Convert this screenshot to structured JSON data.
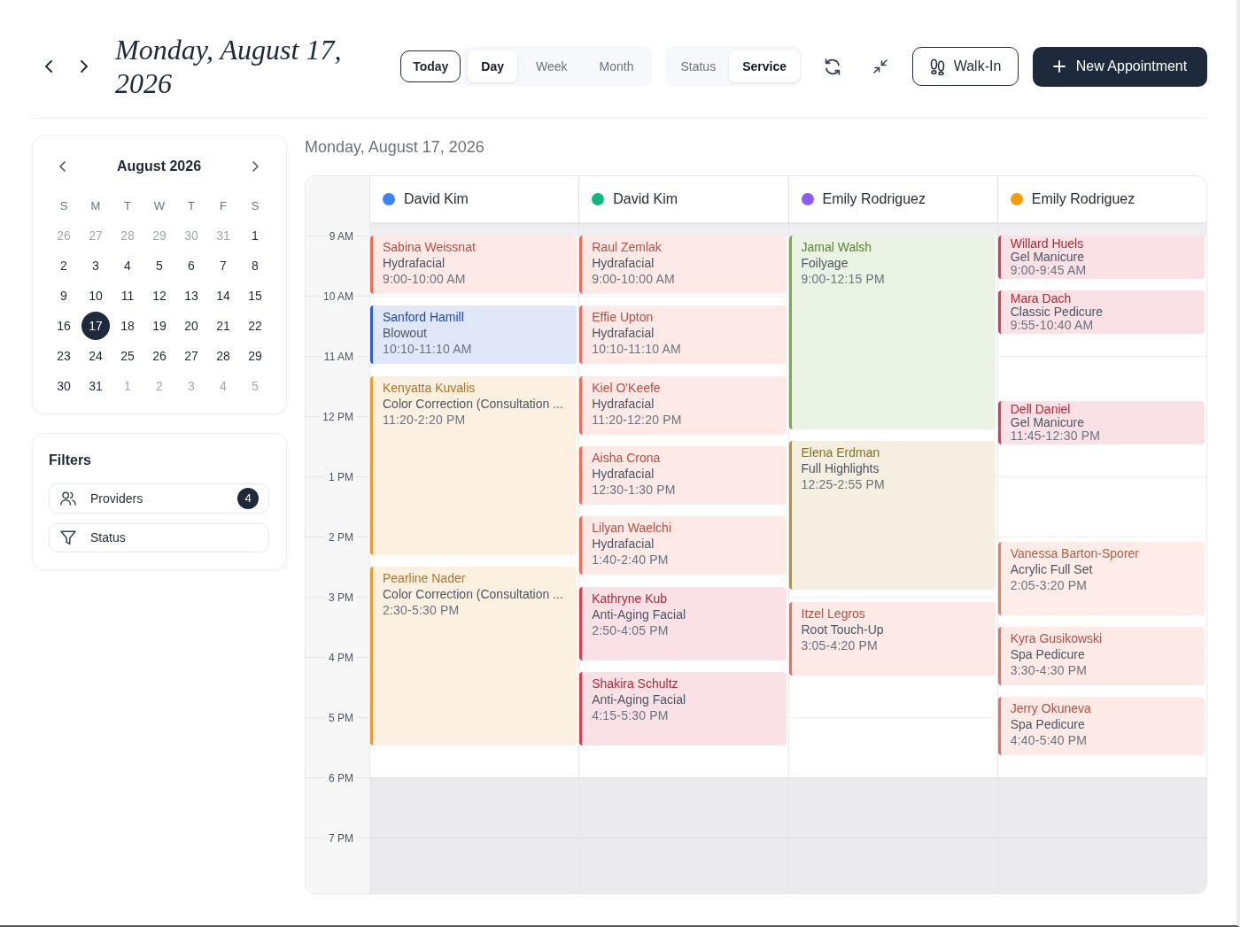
{
  "toolbar": {
    "title": "Monday, August 17, 2026",
    "today_label": "Today",
    "views": [
      {
        "label": "Day",
        "selected": true
      },
      {
        "label": "Week",
        "selected": false
      },
      {
        "label": "Month",
        "selected": false
      }
    ],
    "group_by": [
      {
        "label": "Status",
        "selected": false
      },
      {
        "label": "Service",
        "selected": true
      }
    ],
    "walk_in_label": "Walk-In",
    "new_appointment_label": "New Appointment"
  },
  "mini_calendar": {
    "title": "August 2026",
    "weekdays": [
      "S",
      "M",
      "T",
      "W",
      "T",
      "F",
      "S"
    ],
    "days": [
      {
        "label": "26",
        "other_month": true,
        "selected": false
      },
      {
        "label": "27",
        "other_month": true,
        "selected": false
      },
      {
        "label": "28",
        "other_month": true,
        "selected": false
      },
      {
        "label": "29",
        "other_month": true,
        "selected": false
      },
      {
        "label": "30",
        "other_month": true,
        "selected": false
      },
      {
        "label": "31",
        "other_month": true,
        "selected": false
      },
      {
        "label": "1",
        "other_month": false,
        "selected": false
      },
      {
        "label": "2",
        "other_month": false,
        "selected": false
      },
      {
        "label": "3",
        "other_month": false,
        "selected": false
      },
      {
        "label": "4",
        "other_month": false,
        "selected": false
      },
      {
        "label": "5",
        "other_month": false,
        "selected": false
      },
      {
        "label": "6",
        "other_month": false,
        "selected": false
      },
      {
        "label": "7",
        "other_month": false,
        "selected": false
      },
      {
        "label": "8",
        "other_month": false,
        "selected": false
      },
      {
        "label": "9",
        "other_month": false,
        "selected": false
      },
      {
        "label": "10",
        "other_month": false,
        "selected": false
      },
      {
        "label": "11",
        "other_month": false,
        "selected": false
      },
      {
        "label": "12",
        "other_month": false,
        "selected": false
      },
      {
        "label": "13",
        "other_month": false,
        "selected": false
      },
      {
        "label": "14",
        "other_month": false,
        "selected": false
      },
      {
        "label": "15",
        "other_month": false,
        "selected": false
      },
      {
        "label": "16",
        "other_month": false,
        "selected": false
      },
      {
        "label": "17",
        "other_month": false,
        "selected": true
      },
      {
        "label": "18",
        "other_month": false,
        "selected": false
      },
      {
        "label": "19",
        "other_month": false,
        "selected": false
      },
      {
        "label": "20",
        "other_month": false,
        "selected": false
      },
      {
        "label": "21",
        "other_month": false,
        "selected": false
      },
      {
        "label": "22",
        "other_month": false,
        "selected": false
      },
      {
        "label": "23",
        "other_month": false,
        "selected": false
      },
      {
        "label": "24",
        "other_month": false,
        "selected": false
      },
      {
        "label": "25",
        "other_month": false,
        "selected": false
      },
      {
        "label": "26",
        "other_month": false,
        "selected": false
      },
      {
        "label": "27",
        "other_month": false,
        "selected": false
      },
      {
        "label": "28",
        "other_month": false,
        "selected": false
      },
      {
        "label": "29",
        "other_month": false,
        "selected": false
      },
      {
        "label": "30",
        "other_month": false,
        "selected": false
      },
      {
        "label": "31",
        "other_month": false,
        "selected": false
      },
      {
        "label": "1",
        "other_month": true,
        "selected": false
      },
      {
        "label": "2",
        "other_month": true,
        "selected": false
      },
      {
        "label": "3",
        "other_month": true,
        "selected": false
      },
      {
        "label": "4",
        "other_month": true,
        "selected": false
      },
      {
        "label": "5",
        "other_month": true,
        "selected": false
      }
    ]
  },
  "filters": {
    "title": "Filters",
    "items": [
      {
        "kind": "providers",
        "label": "Providers",
        "count": "4"
      },
      {
        "kind": "status",
        "label": "Status"
      }
    ]
  },
  "schedule": {
    "date_heading": "Monday, August 17, 2026",
    "hours": [
      {
        "label": "9 AM",
        "open": true
      },
      {
        "label": "10 AM",
        "open": true
      },
      {
        "label": "11 AM",
        "open": true
      },
      {
        "label": "12 PM",
        "open": true
      },
      {
        "label": "1 PM",
        "open": true
      },
      {
        "label": "2 PM",
        "open": true
      },
      {
        "label": "3 PM",
        "open": true
      },
      {
        "label": "4 PM",
        "open": true
      },
      {
        "label": "5 PM",
        "open": true
      },
      {
        "label": "6 PM",
        "open": false
      },
      {
        "label": "7 PM",
        "open": false
      }
    ],
    "columns": [
      {
        "provider": "David Kim",
        "color": "#3b82f6",
        "appointments": [
          {
            "client": "Sabina Weissnat",
            "service": "Hydrafacial",
            "time": "9:00-10:00 AM",
            "color": "#ef6b5b"
          },
          {
            "client": "Sanford Hamill",
            "service": "Blowout",
            "time": "10:10-11:10 AM",
            "color": "#2c5ed8"
          },
          {
            "client": "Kenyatta Kuvalis",
            "service": "Color Correction (Consultation ...",
            "time": "11:20-2:20 PM",
            "color": "#e89b35"
          },
          {
            "client": "Pearline Nader",
            "service": "Color Correction (Consultation ...",
            "time": "2:30-5:30 PM",
            "color": "#e89b35"
          }
        ]
      },
      {
        "provider": "David Kim",
        "color": "#10b981",
        "appointments": [
          {
            "client": "Raul Zemlak",
            "service": "Hydrafacial",
            "time": "9:00-10:00 AM",
            "color": "#ef6b5b"
          },
          {
            "client": "Effie Upton",
            "service": "Hydrafacial",
            "time": "10:10-11:10 AM",
            "color": "#ef6b5b"
          },
          {
            "client": "Kiel O'Keefe",
            "service": "Hydrafacial",
            "time": "11:20-12:20 PM",
            "color": "#ef6b5b"
          },
          {
            "client": "Aisha Crona",
            "service": "Hydrafacial",
            "time": "12:30-1:30 PM",
            "color": "#ef6b5b"
          },
          {
            "client": "Lilyan Waelchi",
            "service": "Hydrafacial",
            "time": "1:40-2:40 PM",
            "color": "#ef6b5b"
          },
          {
            "client": "Kathryne Kub",
            "service": "Anti-Aging Facial",
            "time": "2:50-4:05 PM",
            "color": "#e03a50"
          },
          {
            "client": "Shakira Schultz",
            "service": "Anti-Aging Facial",
            "time": "4:15-5:30 PM",
            "color": "#e03a50"
          }
        ]
      },
      {
        "provider": "Emily Rodriguez",
        "color": "#8b5cf6",
        "appointments": [
          {
            "client": "Jamal Walsh",
            "service": "Foilyage",
            "time": "9:00-12:15 PM",
            "color": "#72b043"
          },
          {
            "client": "Elena Erdman",
            "service": "Full Highlights",
            "time": "12:25-2:55 PM",
            "color": "#b8922e"
          },
          {
            "client": "Itzel Legros",
            "service": "Root Touch-Up",
            "time": "3:05-4:20 PM",
            "color": "#ef6b5b"
          }
        ]
      },
      {
        "provider": "Emily Rodriguez",
        "color": "#f59e0b",
        "appointments": [
          {
            "client": "Willard Huels",
            "service": "Gel Manicure",
            "time": "9:00-9:45 AM",
            "color": "#e03a50"
          },
          {
            "client": "Mara Dach",
            "service": "Classic Pedicure",
            "time": "9:55-10:40 AM",
            "color": "#e03a50"
          },
          {
            "client": "Dell Daniel",
            "service": "Gel Manicure",
            "time": "11:45-12:30 PM",
            "color": "#e03a50"
          },
          {
            "client": "Vanessa Barton-Sporer",
            "service": "Acrylic Full Set",
            "time": "2:05-3:20 PM",
            "color": "#f07d5c"
          },
          {
            "client": "Kyra Gusikowski",
            "service": "Spa Pedicure",
            "time": "3:30-4:30 PM",
            "color": "#ef6b5b"
          },
          {
            "client": "Jerry Okuneva",
            "service": "Spa Pedicure",
            "time": "4:40-5:40 PM",
            "color": "#ef6b5b"
          }
        ]
      }
    ]
  }
}
